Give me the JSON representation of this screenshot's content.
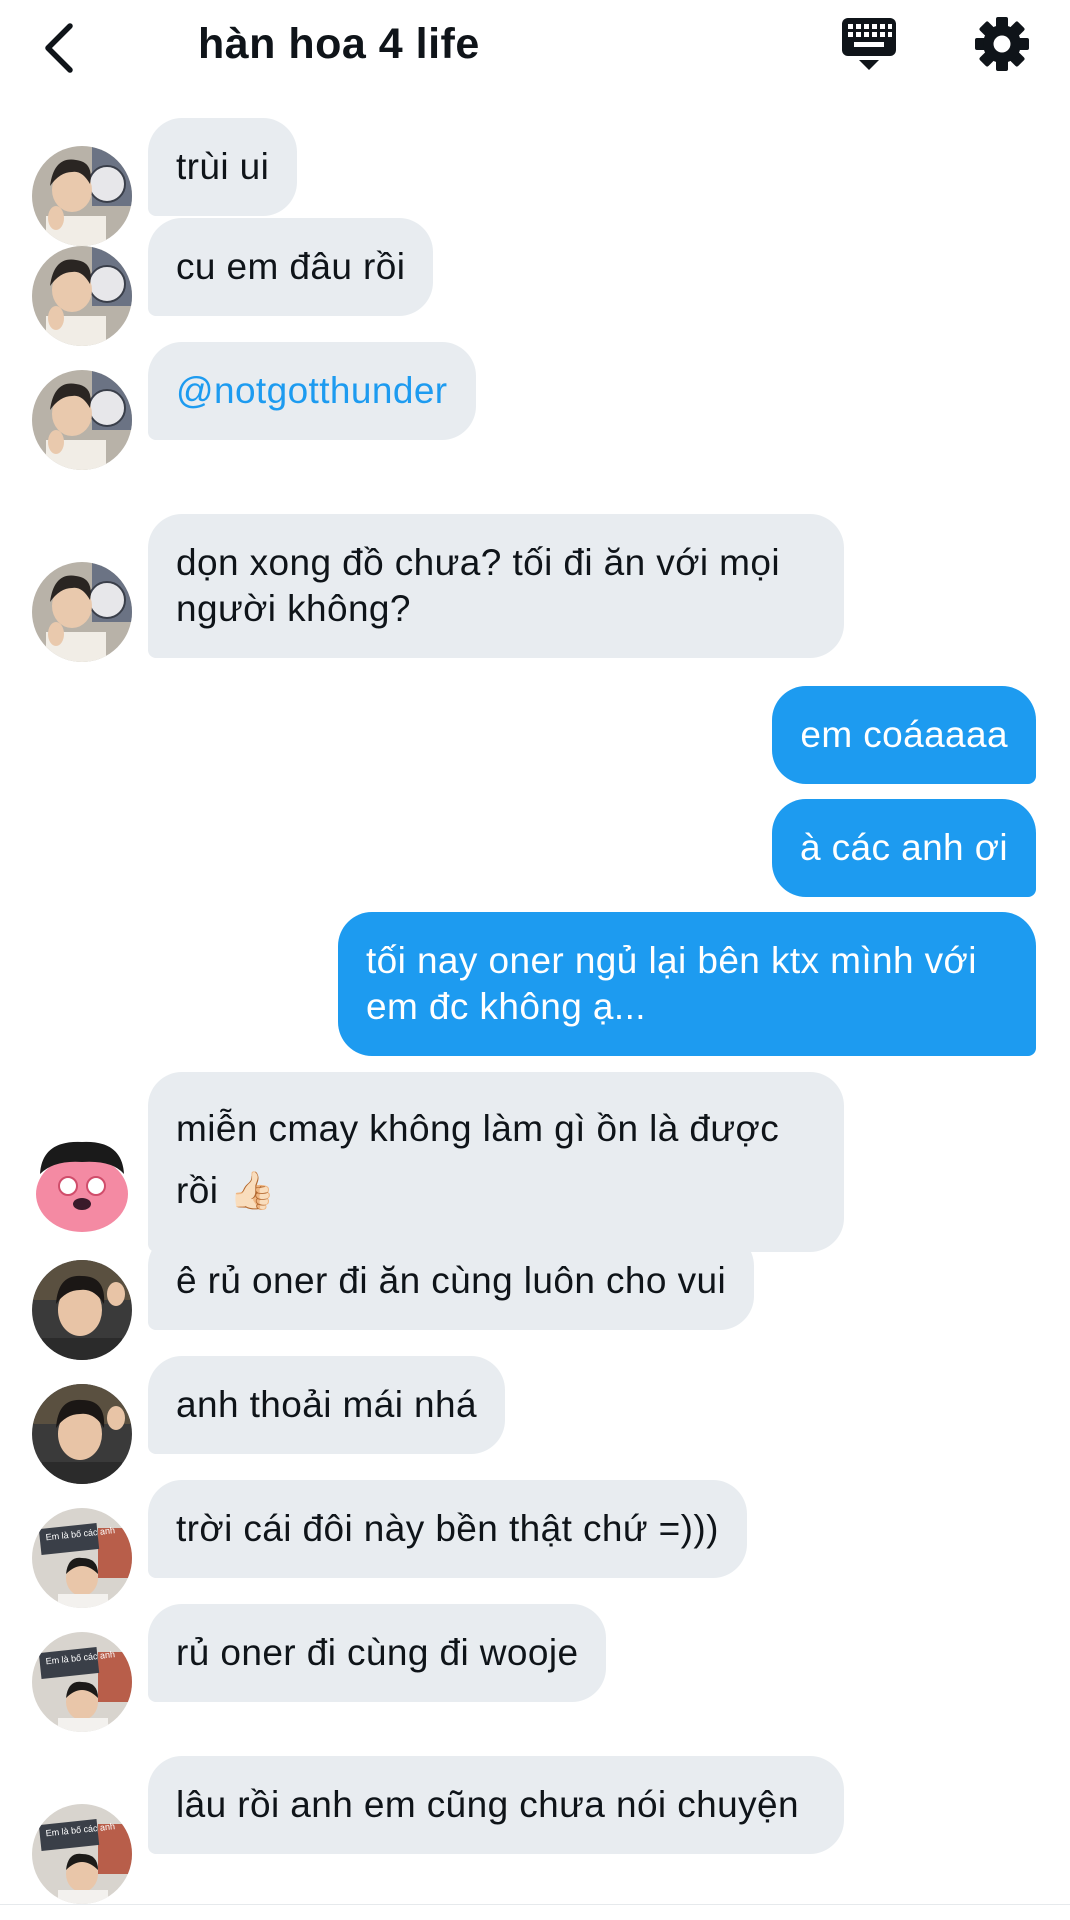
{
  "header": {
    "title": "hàn hoa 4 life",
    "back_icon": "chevron-left-icon",
    "keyboard_icon": "keyboard-icon",
    "settings_icon": "gear-icon"
  },
  "colors": {
    "accent": "#1d9bf0",
    "incoming_bubble": "#e8ecf0",
    "text": "#0f1419"
  },
  "messages": [
    {
      "side": "in",
      "avatar": "avatar-a",
      "text": "trùi ui"
    },
    {
      "side": "in",
      "avatar": "avatar-a",
      "text": "cu em đâu rồi"
    },
    {
      "side": "in",
      "avatar": "avatar-a",
      "text": "@notgotthunder"
    },
    {
      "side": "in",
      "avatar": "avatar-a",
      "text": "dọn xong đồ chưa? tối đi ăn với mọi người không?"
    },
    {
      "side": "out",
      "text": "em coáaaaa"
    },
    {
      "side": "out",
      "text": "à các anh ơi"
    },
    {
      "side": "out",
      "text": "tối nay oner ngủ lại bên ktx mình với em đc không ạ..."
    },
    {
      "side": "in",
      "avatar": "avatar-b",
      "text": "miễn cmay không làm gì ồn là được rồi 👍🏻"
    },
    {
      "side": "in",
      "avatar": "avatar-c",
      "text": "ê rủ oner đi ăn cùng luôn cho vui"
    },
    {
      "side": "in",
      "avatar": "avatar-c",
      "text": "anh thoải mái nhá"
    },
    {
      "side": "in",
      "avatar": "avatar-d",
      "text": "trời cái đôi này bền thật chứ =)))"
    },
    {
      "side": "in",
      "avatar": "avatar-d",
      "text": "rủ oner đi cùng đi wooje"
    },
    {
      "side": "in",
      "avatar": "avatar-d",
      "text": "lâu rồi anh em cũng chưa nói chuyện"
    }
  ],
  "avatar_sign_text": "Em là bố các anh"
}
